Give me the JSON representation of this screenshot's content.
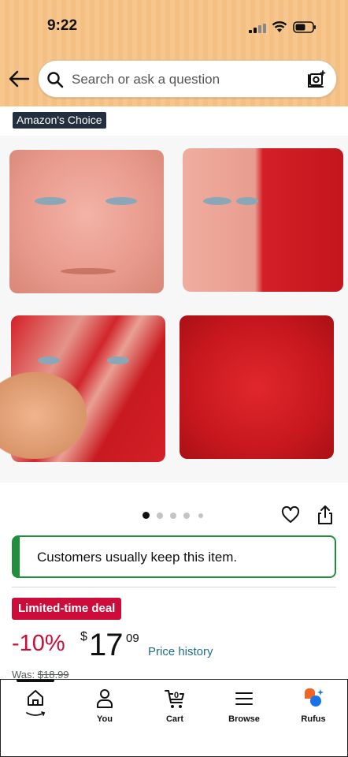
{
  "status_bar": {
    "time": "9:22"
  },
  "search": {
    "placeholder": "Search or ask a question"
  },
  "product": {
    "badge": "Amazon's Choice",
    "image_count": 5,
    "active_image_index": 0,
    "keep_message": "Customers usually keep this item.",
    "deal_badge": "Limited-time deal",
    "discount": "-10%",
    "currency_symbol": "$",
    "price_whole": "17",
    "price_fraction": "09",
    "price_history_label": "Price history",
    "was_label": "Was:",
    "was_price": "$18.99"
  },
  "bottom_nav": {
    "items": [
      {
        "label": "",
        "icon": "home-icon"
      },
      {
        "label": "You",
        "icon": "user-icon"
      },
      {
        "label": "Cart",
        "icon": "cart-icon",
        "count": "0"
      },
      {
        "label": "Browse",
        "icon": "menu-icon"
      },
      {
        "label": "Rufus",
        "icon": "rufus-icon"
      }
    ]
  },
  "colors": {
    "header_bg": "#f6c68c",
    "deal_red": "#cc0c39",
    "keep_green": "#1f8f3b",
    "link_blue": "#1d6e8c",
    "badge_navy": "#232f3e",
    "rufus_orange": "#f26522",
    "rufus_blue": "#1a73e8"
  }
}
